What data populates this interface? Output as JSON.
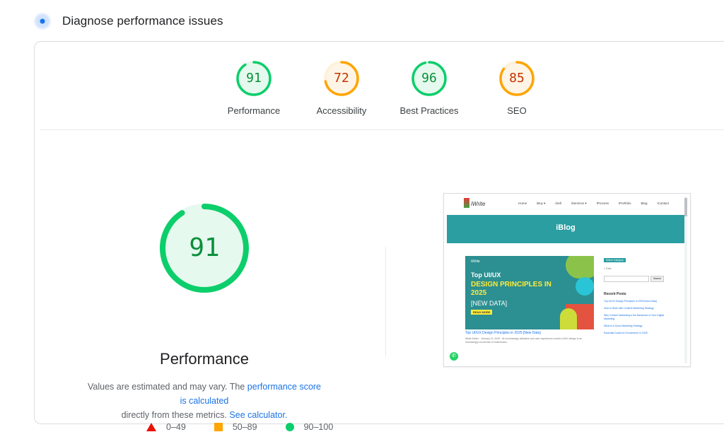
{
  "header": {
    "title": "Diagnose performance issues",
    "icon": "lighthouse-icon"
  },
  "scores": [
    {
      "label": "Performance",
      "value": 91,
      "color": "#0cce6b",
      "text_color": "#0a8f3a"
    },
    {
      "label": "Accessibility",
      "value": 72,
      "color": "#ffa400",
      "text_color": "#c33300"
    },
    {
      "label": "Best Practices",
      "value": 96,
      "color": "#0cce6b",
      "text_color": "#0a8f3a"
    },
    {
      "label": "SEO",
      "value": 85,
      "color": "#ffa400",
      "text_color": "#c33300"
    }
  ],
  "main": {
    "score": 91,
    "title": "Performance",
    "desc_1": "Values are estimated and may vary. The ",
    "desc_link_1": "performance score is calculated",
    "desc_2": "directly from these metrics. ",
    "desc_link_2": "See calculator.",
    "color": "#0cce6b"
  },
  "legend": [
    {
      "label": "0–49",
      "color": "#eb0f00",
      "shape": "triangle"
    },
    {
      "label": "50–89",
      "color": "#ffa400",
      "shape": "square"
    },
    {
      "label": "90–100",
      "color": "#0cce6b",
      "shape": "circle"
    }
  ],
  "screenshot": {
    "logo": "iWrite",
    "menu": [
      "Home",
      "iBuy ▾",
      "iSell",
      "iServices ▾",
      "iProcess",
      "iPortfolio",
      "Blog",
      "iContact"
    ],
    "banner_title": "iBlog",
    "feature": {
      "mini_logo": "iWrite",
      "line1": "Top UI/UX",
      "line2": "DESIGN PRINCIPLES IN 2025",
      "line3": "[NEW DATA]",
      "button": "READ MORE"
    },
    "post_title": "Top UI/UX Design Principles in 2025 [New Data]",
    "post_meta": "iWrite Editor · January 10, 2025 · An increasingly attractive and user-experience-centric UI/UX design is an increasingly crucial ask of businesses...",
    "sidebar_tag": "Select Category",
    "sidebar_filter": "≡ Filter",
    "search_btn": "Search",
    "recent_title": "Recent Posts",
    "recent": [
      "Top UI/UX Design Principles in 2025 [New Data]",
      "How to Work with Content Marketing Strategy",
      "Why Content Marketing is the Backbone of Your Digital Marketing",
      "What is a Good Marketing Strategy",
      "Essential Guide for Ecommerce in 2025"
    ],
    "wa_icon": "whatsapp-icon"
  }
}
